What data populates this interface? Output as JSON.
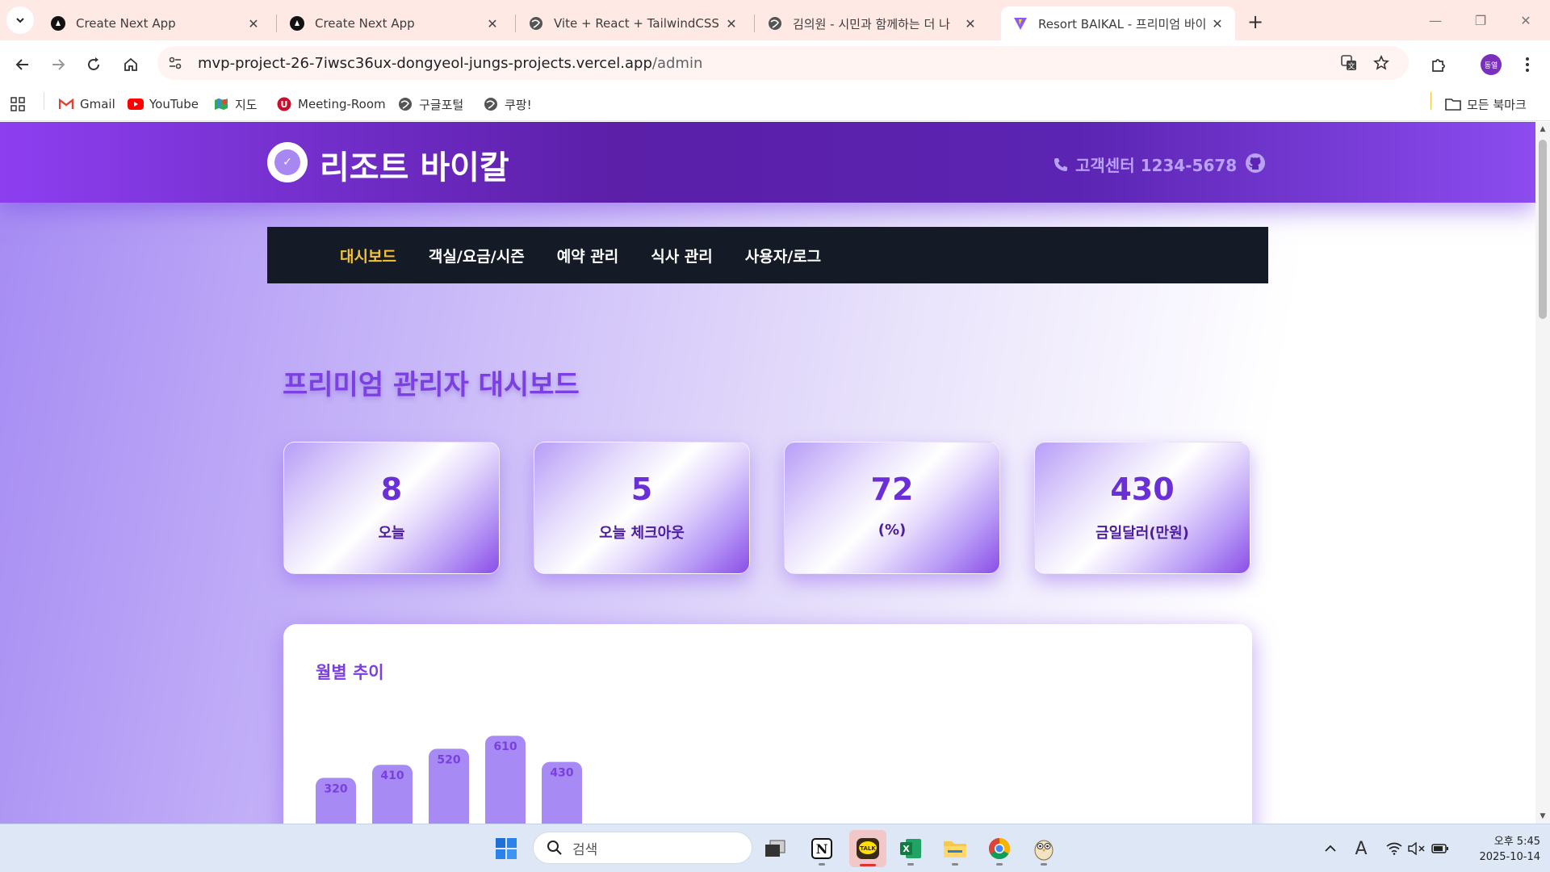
{
  "browser": {
    "tabs": [
      {
        "title": "Create Next App",
        "icon": "nextjs-icon"
      },
      {
        "title": "Create Next App",
        "icon": "nextjs-icon"
      },
      {
        "title": "Vite + React + TailwindCSS",
        "icon": "globe-icon"
      },
      {
        "title": "김의원 - 시민과 함께하는 더 나",
        "icon": "globe-icon"
      },
      {
        "title": "Resort BAIKAL - 프리미엄 바이",
        "icon": "vite-icon",
        "active": true
      }
    ],
    "url_host": "mvp-project-26-7iwsc36ux-dongyeol-jungs-projects.vercel.app",
    "url_path": "/admin",
    "profile_initials": "동열",
    "bookmarks": [
      {
        "label": "Gmail",
        "icon": "gmail-icon"
      },
      {
        "label": "YouTube",
        "icon": "youtube-icon"
      },
      {
        "label": "지도",
        "icon": "maps-icon"
      },
      {
        "label": "Meeting-Room",
        "icon": "meeting-room-icon"
      },
      {
        "label": "구글포털",
        "icon": "globe-icon"
      },
      {
        "label": "쿠팡!",
        "icon": "globe-icon"
      }
    ],
    "all_bookmarks_label": "모든 북마크"
  },
  "site": {
    "brand": "리조트 바이칼",
    "customer_center": "고객센터 1234-5678",
    "nav": [
      {
        "label": "대시보드",
        "active": true
      },
      {
        "label": "객실/요금/시즌"
      },
      {
        "label": "예약 관리"
      },
      {
        "label": "식사 관리"
      },
      {
        "label": "사용자/로그"
      }
    ],
    "dashboard_title": "프리미엄 관리자 대시보드",
    "stats": [
      {
        "value": "8",
        "label": "오늘"
      },
      {
        "value": "5",
        "label": "오늘 체크아웃"
      },
      {
        "value": "72",
        "label": "(%)"
      },
      {
        "value": "430",
        "label": "금일달러(만원)"
      }
    ],
    "chart_title": "월별 추이"
  },
  "chart_data": {
    "type": "bar",
    "title": "월별 추이",
    "categories": [
      "",
      "",
      "",
      "",
      ""
    ],
    "values": [
      320,
      410,
      520,
      610,
      430
    ],
    "bar_color": "#a88af5",
    "label_color": "#7a3fe0"
  },
  "taskbar": {
    "search_placeholder": "검색",
    "time": "오후 5:45",
    "date": "2025-10-14"
  },
  "colors": {
    "header_purple": "#5b1fa8",
    "nav_dark": "#141a26",
    "nav_active": "#f3c43a",
    "accent": "#7b3fe2"
  }
}
